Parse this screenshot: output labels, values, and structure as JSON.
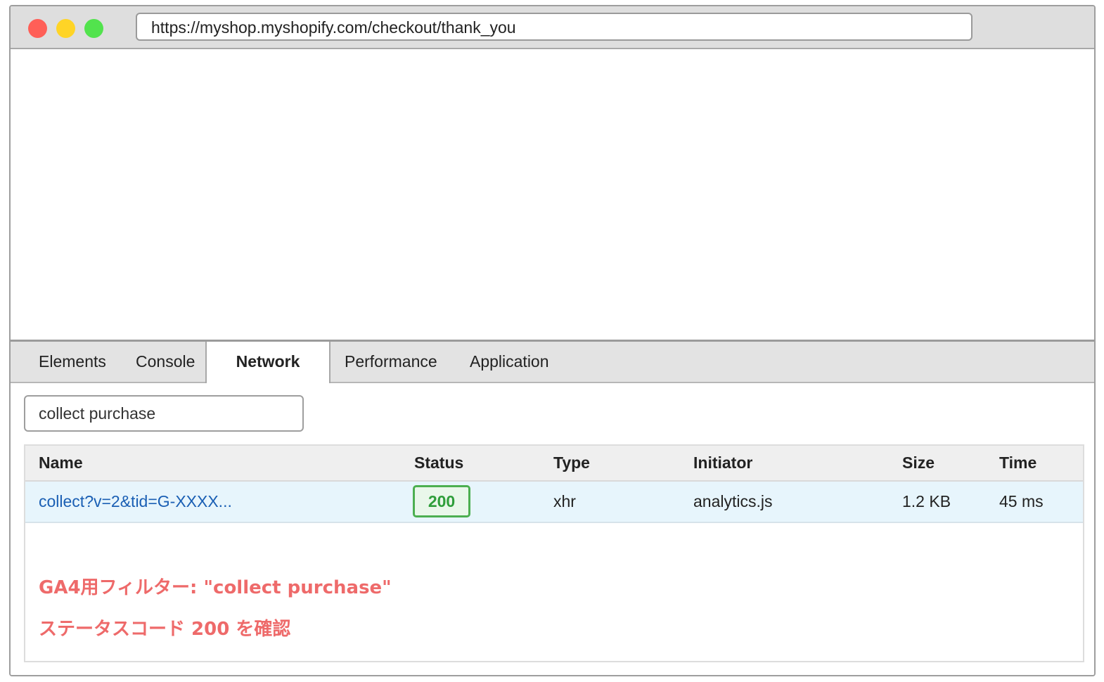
{
  "browser": {
    "url": "https://myshop.myshopify.com/checkout/thank_you"
  },
  "devtools": {
    "tabs": [
      "Elements",
      "Console",
      "Network",
      "Performance",
      "Application"
    ],
    "active_tab": "Network",
    "filter": {
      "value": "collect purchase"
    },
    "table": {
      "columns": [
        "Name",
        "Status",
        "Type",
        "Initiator",
        "Size",
        "Time"
      ],
      "rows": [
        {
          "name": "collect?v=2&tid=G-XXXX...",
          "status": "200",
          "type": "xhr",
          "initiator": "analytics.js",
          "size": "1.2 KB",
          "time": "45 ms"
        }
      ]
    },
    "notes": [
      "GA4用フィルター: \"collect purchase\"",
      "ステータスコード 200 を確認"
    ]
  },
  "colors": {
    "status_ok": "#4caf50",
    "annotation": "#ee6a6a",
    "link": "#1a5fb4",
    "selected_row": "#e7f5fc"
  }
}
